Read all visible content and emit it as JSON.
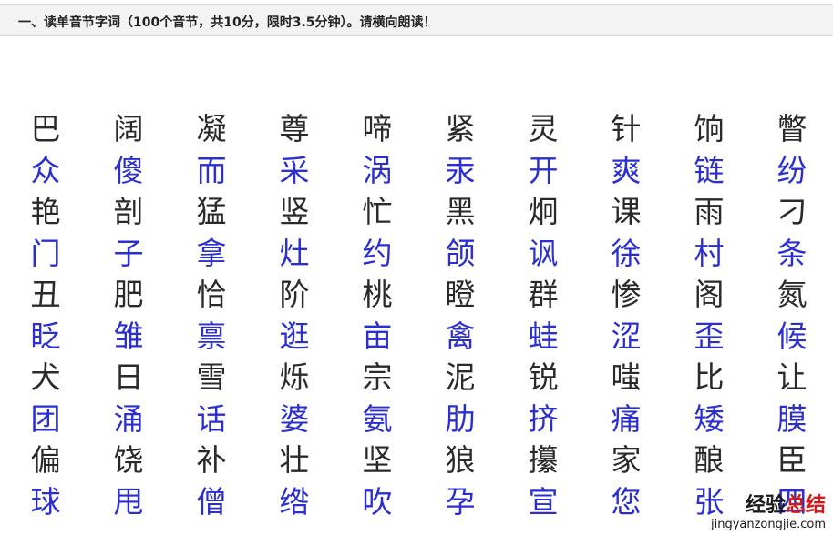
{
  "header": {
    "instruction": "一、读单音节字词（100个音节，共10分，限时3.5分钟）。请横向朗读！"
  },
  "colors": {
    "black_row": "#2a2a2a",
    "blue_row": "#2b2fd0",
    "watermark_accent": "#d11a1a"
  },
  "rows": [
    [
      "巴",
      "阔",
      "凝",
      "尊",
      "啼",
      "紧",
      "灵",
      "针",
      "饷",
      "瞥"
    ],
    [
      "众",
      "傻",
      "而",
      "采",
      "涡",
      "汞",
      "开",
      "爽",
      "链",
      "纷"
    ],
    [
      "艳",
      "剖",
      "猛",
      "竖",
      "忙",
      "黑",
      "炯",
      "课",
      "雨",
      "刁"
    ],
    [
      "门",
      "子",
      "拿",
      "灶",
      "约",
      "颌",
      "讽",
      "徐",
      "村",
      "条"
    ],
    [
      "丑",
      "肥",
      "恰",
      "阶",
      "桃",
      "瞪",
      "群",
      "惨",
      "阁",
      "氮"
    ],
    [
      "眨",
      "雏",
      "禀",
      "逛",
      "亩",
      "禽",
      "蛙",
      "涩",
      "歪",
      "候"
    ],
    [
      "犬",
      "日",
      "雪",
      "烁",
      "宗",
      "泥",
      "锐",
      "嗤",
      "比",
      "让"
    ],
    [
      "团",
      "涌",
      "话",
      "婆",
      "氨",
      "肋",
      "挤",
      "痛",
      "矮",
      "膜"
    ],
    [
      "偏",
      "饶",
      "补",
      "壮",
      "坚",
      "狼",
      "攥",
      "家",
      "酿",
      "臣"
    ],
    [
      "球",
      "甩",
      "僧",
      "绺",
      "吹",
      "孕",
      "宣",
      "您",
      "张",
      "四"
    ]
  ],
  "watermark": {
    "title_part1": "经验",
    "title_part2": "总结",
    "url": "jingyanzongjie.com"
  }
}
